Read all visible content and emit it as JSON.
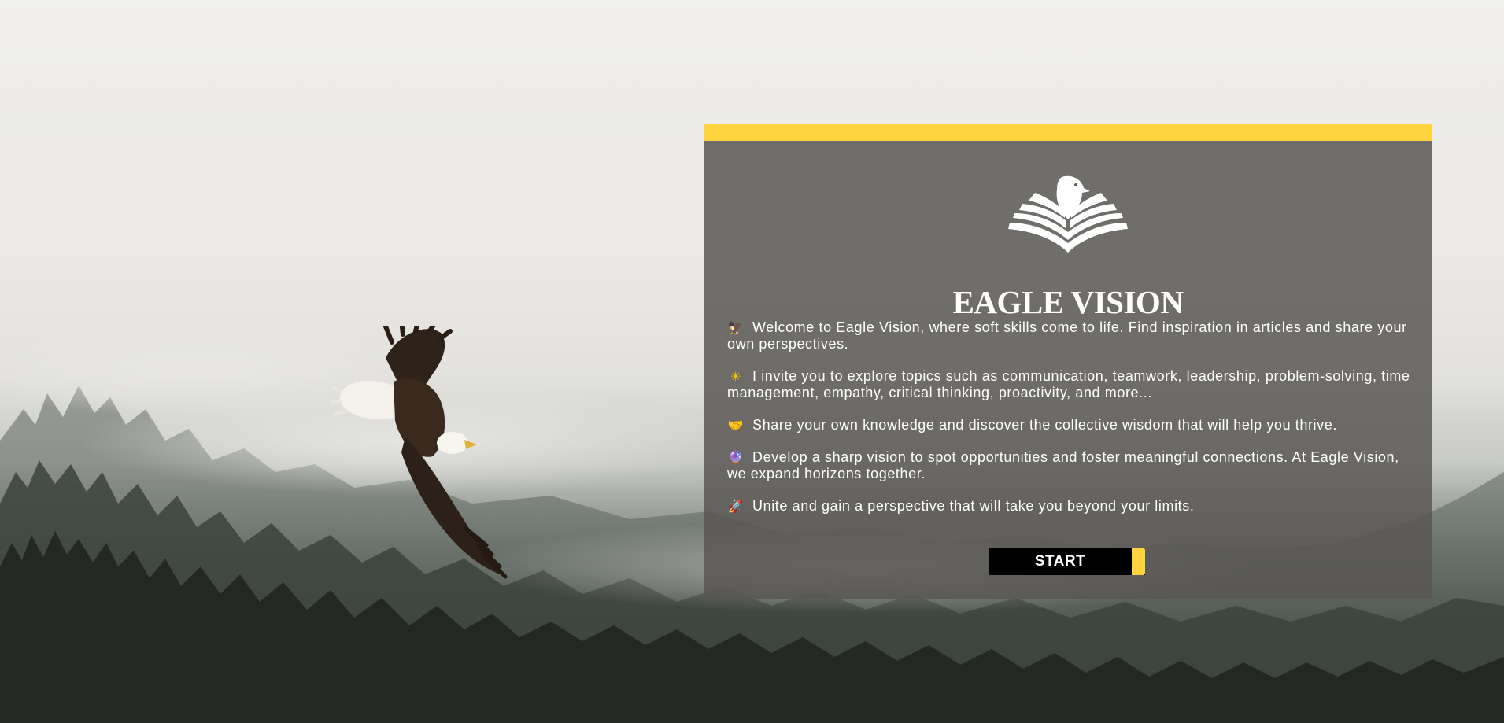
{
  "brand": {
    "title": "EAGLE VISION"
  },
  "intro": {
    "paragraphs": [
      {
        "icon": "eagle-icon",
        "emoji": "🦅",
        "text": "Welcome to Eagle Vision, where soft skills come to life. Find inspiration in articles and share your own perspectives."
      },
      {
        "icon": "sun-icon",
        "emoji": "☀",
        "text": "I invite you to explore topics such as communication, teamwork, leadership, problem-solving, time management, empathy, critical thinking, proactivity, and more..."
      },
      {
        "icon": "handshake-icon",
        "emoji": "🤝",
        "text": "Share your own knowledge and discover the collective wisdom that will help you thrive."
      },
      {
        "icon": "crystal-ball-icon",
        "emoji": "🔮",
        "text": "Develop a sharp vision to spot opportunities and foster meaningful connections. At Eagle Vision, we expand horizons together."
      },
      {
        "icon": "rocket-icon",
        "emoji": "🚀",
        "text": "Unite and gain a perspective that will take you beyond your limits."
      }
    ]
  },
  "cta": {
    "start_label": "START"
  },
  "colors": {
    "accent": "#fed33d",
    "card": "#585652",
    "button": "#000000",
    "text": "#ffffff"
  }
}
